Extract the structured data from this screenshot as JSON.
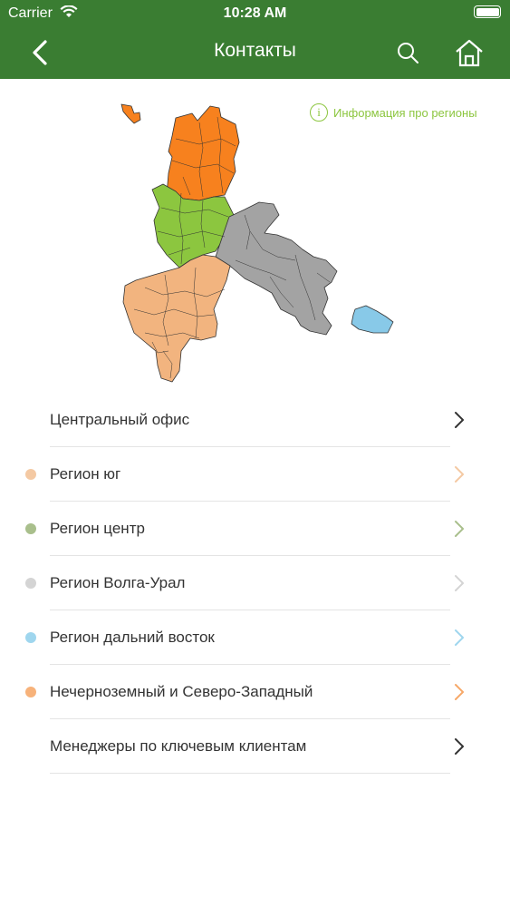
{
  "status": {
    "carrier": "Carrier",
    "time": "10:28 AM"
  },
  "nav": {
    "title": "Контакты"
  },
  "map": {
    "info_label": "Информация про регионы"
  },
  "colors": {
    "header_bg": "#3a7d32",
    "south": "#f2b47f",
    "center": "#8cc63f",
    "volga": "#a3a3a3",
    "fareast": "#88c9e8",
    "northwest": "#f7811e"
  },
  "list": [
    {
      "label": "Центральный офис",
      "dot_color": null,
      "chevron_color": "#333333"
    },
    {
      "label": "Регион юг",
      "dot_color": "#f4c9a3",
      "chevron_color": "#f4c9a3"
    },
    {
      "label": "Регион центр",
      "dot_color": "#a9bf8c",
      "chevron_color": "#a9bf8c"
    },
    {
      "label": "Регион Волга-Урал",
      "dot_color": "#d4d4d4",
      "chevron_color": "#d4d4d4"
    },
    {
      "label": "Регион дальний восток",
      "dot_color": "#9fd6ee",
      "chevron_color": "#9fd6ee"
    },
    {
      "label": "Нечерноземный и Северо-Западный",
      "dot_color": "#f7b27a",
      "chevron_color": "#f7a868"
    },
    {
      "label": "Менеджеры по ключевым клиентам",
      "dot_color": null,
      "chevron_color": "#333333"
    }
  ]
}
